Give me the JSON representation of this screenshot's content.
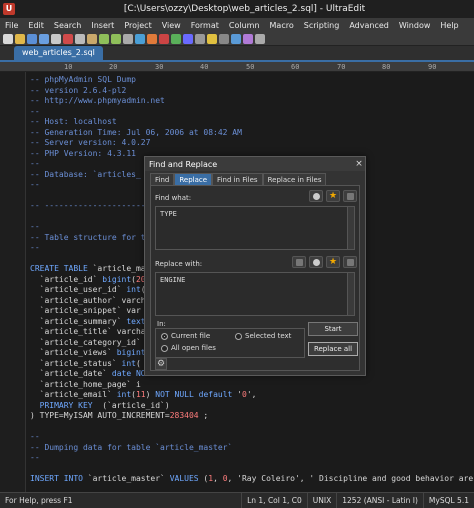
{
  "window": {
    "title": "[C:\\Users\\ozzy\\Desktop\\web_articles_2.sql] - UltraEdit"
  },
  "menu": [
    "File",
    "Edit",
    "Search",
    "Insert",
    "Project",
    "View",
    "Format",
    "Column",
    "Macro",
    "Scripting",
    "Advanced",
    "Window",
    "Help"
  ],
  "document_tab": "web_articles_2.sql",
  "ruler": [
    "10",
    "20",
    "30",
    "40",
    "50",
    "60",
    "70",
    "80",
    "90"
  ],
  "code": [
    "-- phpMyAdmin SQL Dump",
    "-- version 2.6.4-pl2",
    "-- http://www.phpmyadmin.net",
    "--",
    "-- Host: localhost",
    "-- Generation Time: Jul 06, 2006 at 08:42 AM",
    "-- Server version: 4.0.27",
    "-- PHP Version: 4.3.11",
    "--",
    "-- Database: `articles_",
    "--",
    "",
    "-- -------------------------",
    "",
    "--",
    "-- Table structure for t",
    "--",
    "",
    "CREATE TABLE `article_ma",
    "  `article_id` bigint(20",
    "  `article_user_id` int(",
    "  `article_author` varch",
    "  `article_snippet` var",
    "  `article_summary` text",
    "  `article_title` varcha",
    "  `article_category_id`",
    "  `article_views` bigint",
    "  `article_status` int(",
    "  `article_date` date NO",
    "  `article_home_page` i",
    "  `article_email` int(11) NOT NULL default '0',",
    "  PRIMARY KEY  (`article_id`)",
    ") TYPE=MyISAM AUTO_INCREMENT=283404 ;",
    "",
    "--",
    "-- Dumping data for table `article_master`",
    "--",
    "",
    "INSERT INTO `article_master` VALUES (1, 0, 'Ray Coleiro', ' Discipline and good behavior are"
  ],
  "dialog": {
    "title": "Find and Replace",
    "close": "×",
    "tabs": [
      "Find",
      "Replace",
      "Find in Files",
      "Replace in Files"
    ],
    "find_label": "Find what:",
    "find_value": "TYPE",
    "replace_label": "Replace with:",
    "replace_value": "ENGINE",
    "in_label": "In:",
    "scope_current": "Current file",
    "scope_selected": "Selected text",
    "scope_all": "All open files",
    "start_button": "Start",
    "replace_all_button": "Replace all"
  },
  "status": {
    "help": "For Help, press F1",
    "position": "Ln 1, Col 1, C0",
    "line_ending": "UNIX",
    "encoding": "1252 (ANSI - Latin I)",
    "syntax": "MySQL 5.1"
  },
  "colors": {
    "accent": "#3a6ea5",
    "comment": "#6b8fd6",
    "keyword": "#6fa8ff",
    "number": "#ff7d7d"
  }
}
